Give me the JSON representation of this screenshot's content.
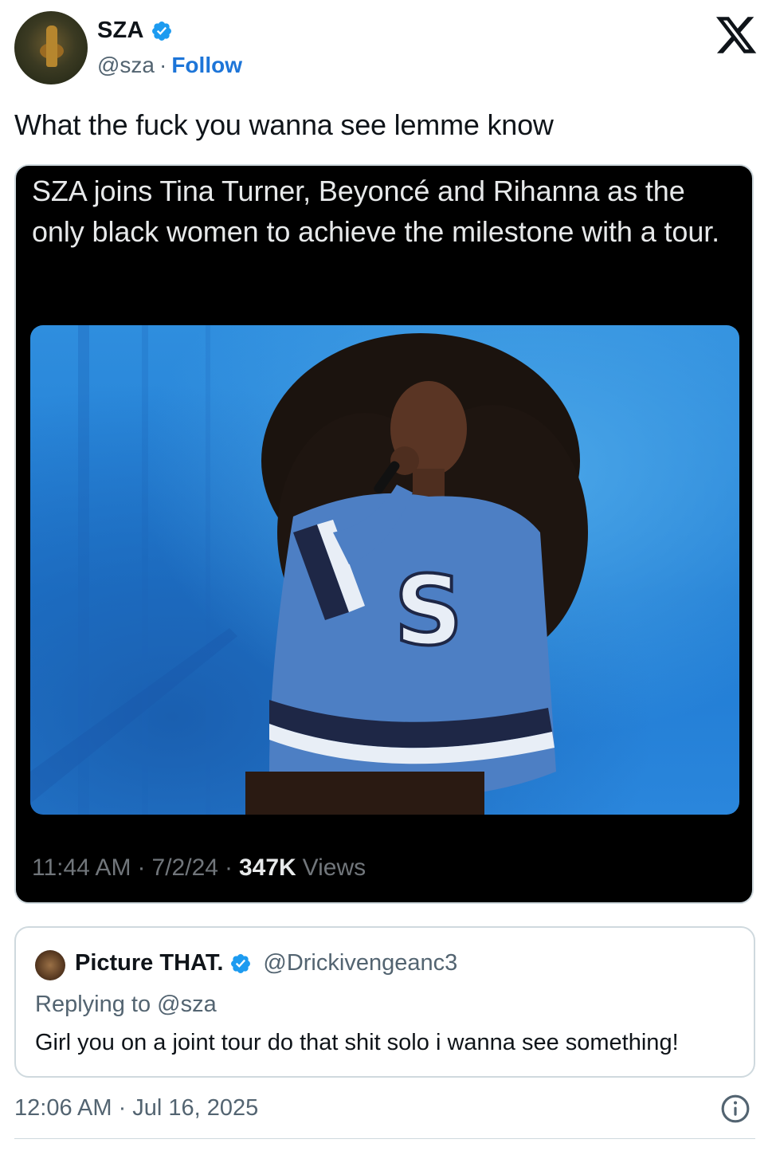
{
  "tweet": {
    "author_name": "SZA",
    "author_handle": "@sza",
    "separator": "·",
    "follow_label": "Follow",
    "text": "What the fuck you wanna see lemme know",
    "timestamp": "12:06 AM · Jul 16, 2025"
  },
  "embedded": {
    "text": "SZA joins Tina Turner, Beyoncé and Rihanna as the only black women to achieve the milestone with a tour.",
    "time": "11:44 AM",
    "date": "7/2/24",
    "separator": "·",
    "views_count": "347K",
    "views_label": "Views"
  },
  "quote": {
    "author_name": "Picture THAT.",
    "author_handle": "@Drickivengeanc3",
    "replying_prefix": "Replying to",
    "replying_to": "@sza",
    "text": "Girl you on a joint tour do that shit solo i wanna see something!"
  },
  "colors": {
    "accent": "#1d9bf0",
    "follow": "#1d75d8",
    "muted": "#536471",
    "text": "#0f1419"
  },
  "icons": [
    "verified-badge-icon",
    "x-logo-icon",
    "info-icon"
  ]
}
